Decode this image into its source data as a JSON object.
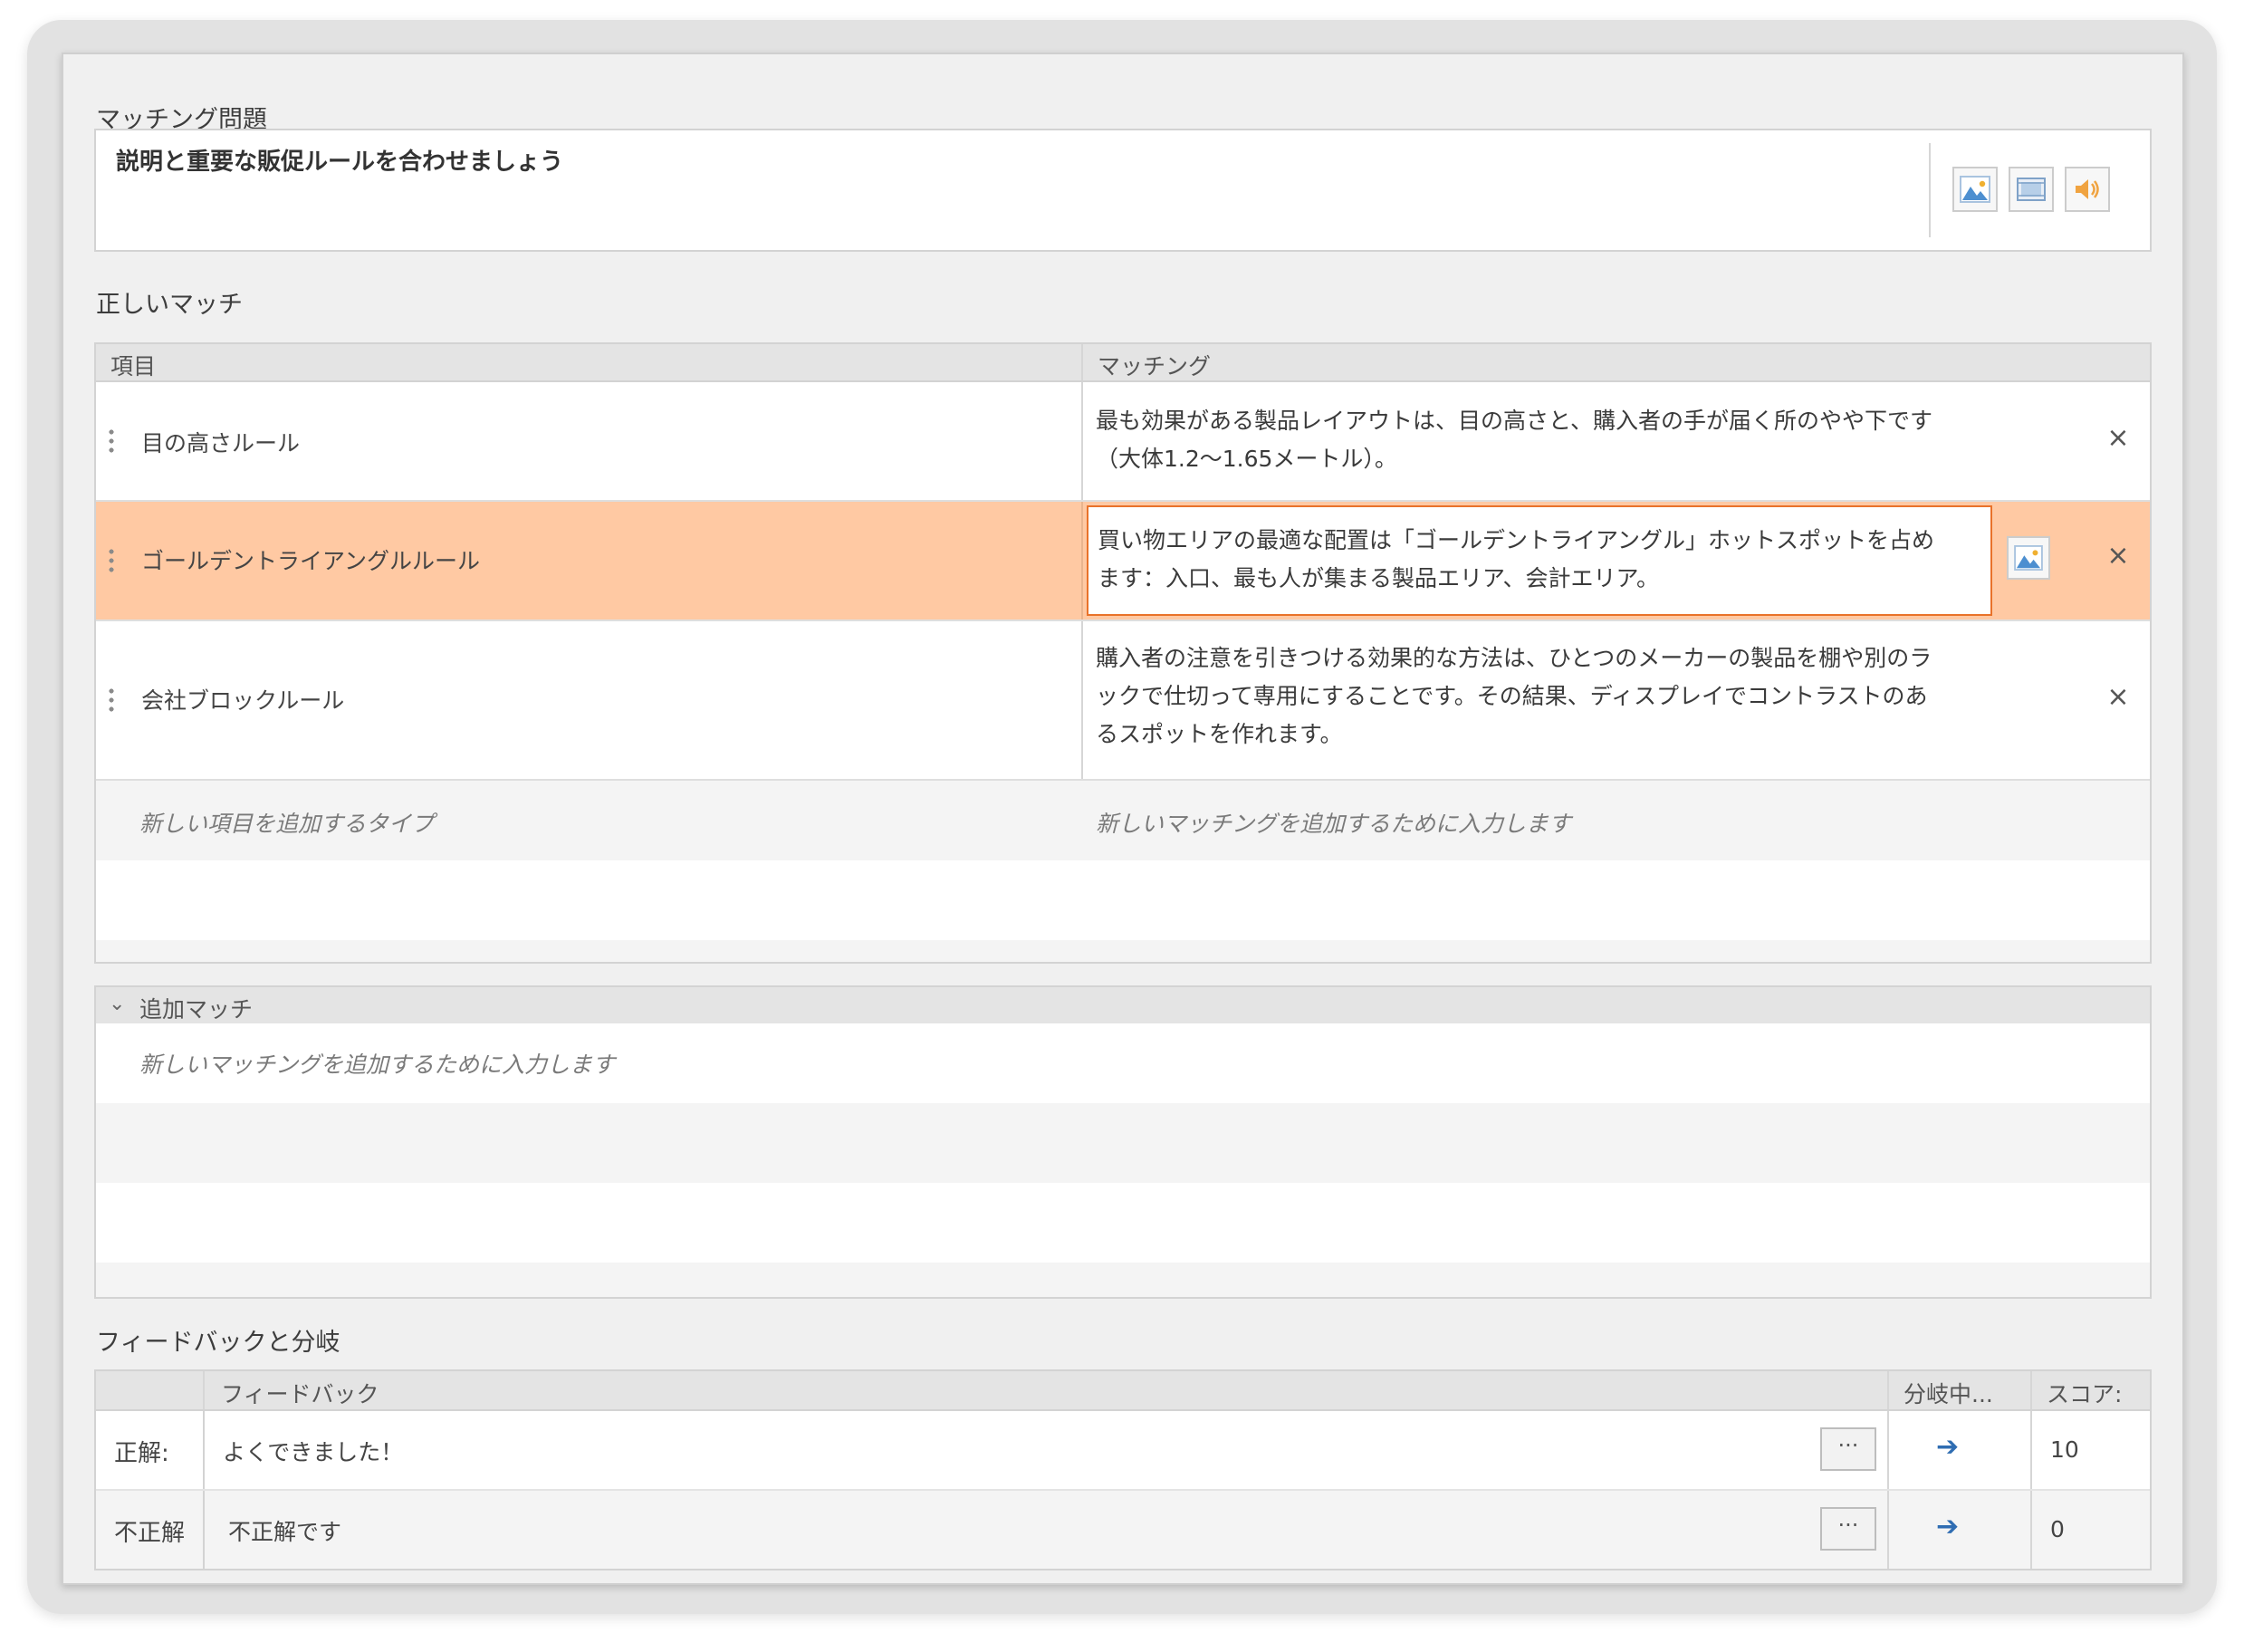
{
  "question": {
    "section_label": "マッチング問題",
    "text": "説明と重要な販促ルールを合わせましょう",
    "media_buttons": [
      {
        "icon": "image-icon"
      },
      {
        "icon": "video-icon"
      },
      {
        "icon": "audio-icon"
      }
    ]
  },
  "matches": {
    "section_label": "正しいマッチ",
    "header_item": "項目",
    "header_match": "マッチング",
    "rows": [
      {
        "item": "目の高さルール",
        "match_line1": "最も効果がある製品レイアウトは、目の高さと、購入者の手が届く所のやや下です",
        "match_line2": "（大体1.2～1.65メートル）。"
      },
      {
        "item": "ゴールデントライアングルルール",
        "match_line1": "買い物エリアの最適な配置は「ゴールデントライアングル」ホットスポットを占め",
        "match_line2": "ます：入口、最も人が集まる製品エリア、会計エリア。"
      },
      {
        "item": "会社ブロックルール",
        "match_line1": "購入者の注意を引きつける効果的な方法は、ひとつのメーカーの製品を棚や別のラ",
        "match_line2": "ックで仕切って専用にすることです。その結果、ディスプレイでコントラストのあ",
        "match_line3": "るスポットを作れます。"
      }
    ],
    "add_item_placeholder": "新しい項目を追加するタイプ",
    "add_match_placeholder": "新しいマッチングを追加するために入力します",
    "close_glyph": "×"
  },
  "additional": {
    "header": "追加マッチ",
    "placeholder": "新しいマッチングを追加するために入力します"
  },
  "feedback": {
    "section_label": "フィードバックと分岐",
    "header_feedback": "フィードバック",
    "header_branch": "分岐中...",
    "header_score": "スコア:",
    "rows": [
      {
        "key": "正解:",
        "text": "よくできました！",
        "score": "10"
      },
      {
        "key": "不正解",
        "text": "不正解です",
        "score": "0"
      }
    ],
    "dots": "···",
    "arrow": "➔"
  },
  "colors": {
    "selected_row": "#ffc9a3",
    "edit_border": "#e9722a",
    "arrow": "#2f6db2"
  }
}
